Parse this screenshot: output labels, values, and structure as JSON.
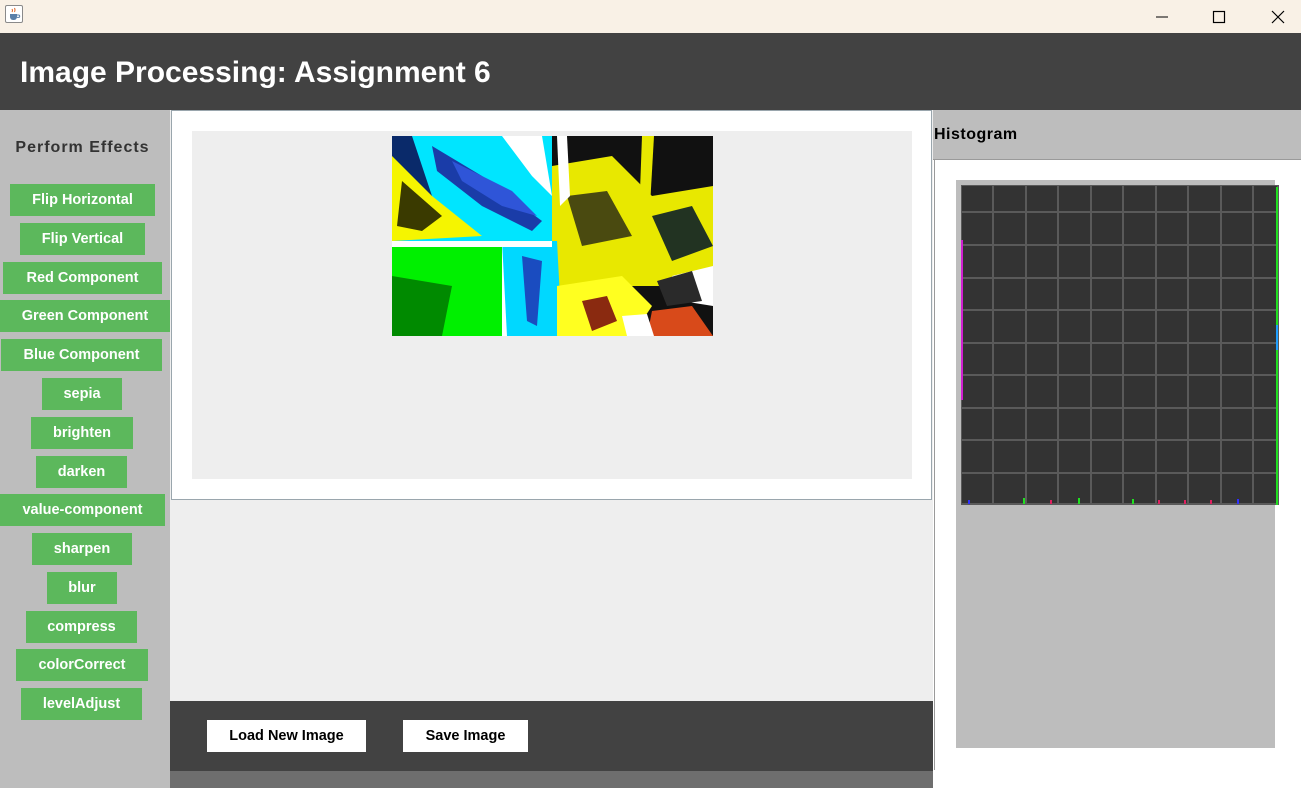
{
  "window": {
    "app_icon": "java-coffee-icon",
    "minimize_icon": "minimize-icon",
    "maximize_icon": "maximize-icon",
    "close_icon": "close-icon"
  },
  "header": {
    "title": "Image Processing: Assignment 6"
  },
  "sidebar": {
    "title": "Perform Effects",
    "accent_color": "#5cb85c",
    "buttons": [
      "Flip Horizontal",
      "Flip Vertical",
      "Red Component",
      "Green Component",
      "Blue Component",
      "sepia",
      "brighten",
      "darken",
      "value-component",
      "sharpen",
      "blur",
      "compress",
      "colorCorrect",
      "levelAdjust"
    ]
  },
  "bottom": {
    "load_label": "Load New Image",
    "save_label": "Save Image"
  },
  "histogram": {
    "title": "Histogram",
    "background": "#333333",
    "grid_color": "#5a5a5a"
  }
}
